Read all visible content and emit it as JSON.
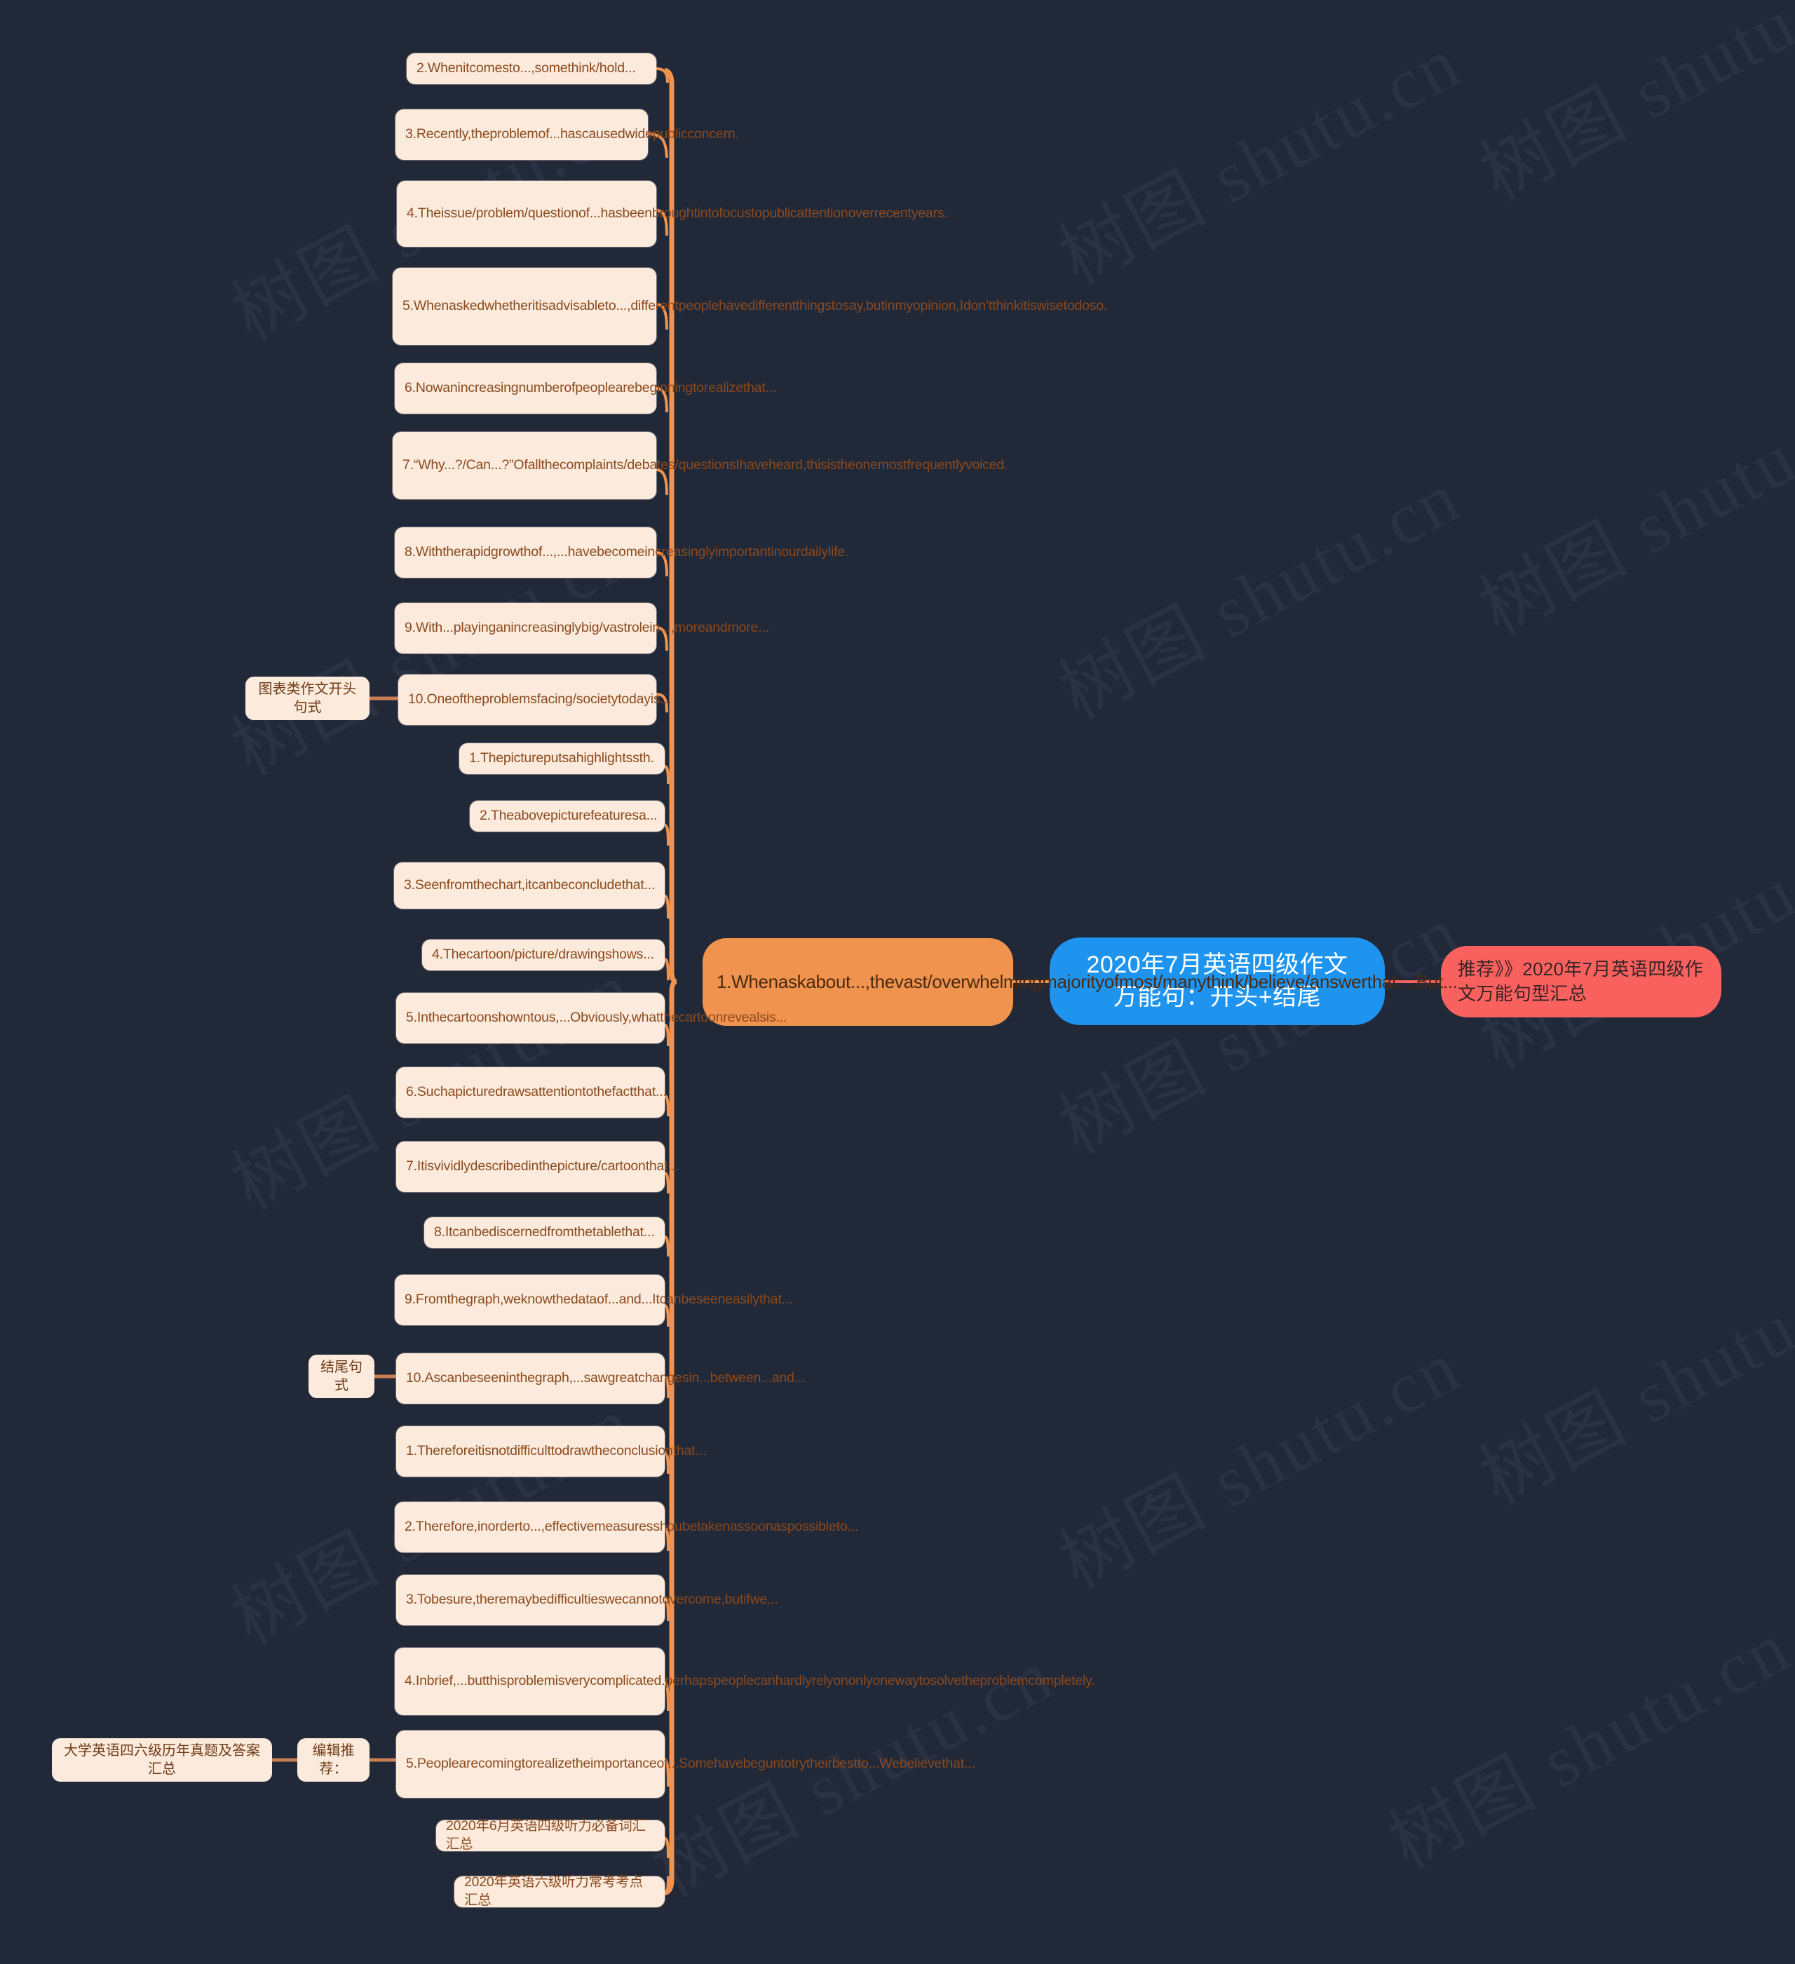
{
  "meta": {
    "background_color": "#212838",
    "leaf_fill": "#fcebdc",
    "leaf_text": "#8a4a1f",
    "root_fill": "#1f94ef",
    "orange_fill": "#f0934e",
    "red_fill": "#f9615f",
    "edge_color": "#f0934e",
    "watermark_text": "树图 shutu.cn"
  },
  "root": {
    "label": "2020年7月英语四级作文万能句：开头+结尾",
    "line1": "2020年7月英语四级作文",
    "line2": "万能句：开头+结尾"
  },
  "recommend": {
    "label": "推荐》》2020年7月英语四级作文万能句型汇总"
  },
  "opening_first": {
    "label": "1.Whenaskabout...,thevast/overwhelmingmajorityofmost/manythink/believe/answerthat....But..."
  },
  "branches": {
    "chart_opening": "图表类作文开头句式",
    "ending": "结尾句式",
    "editor_pick": "编辑推荐：",
    "exam_archive": "大学英语四六级历年真题及答案汇总"
  },
  "opening_items": [
    "2.Whenitcomesto...,somethink/hold...",
    "3.Recently,theproblemof...hascausedwidepublicconcern.",
    "4.Theissue/problem/questionof...hasbeenbroughtintofocustopublicattentionoverrecentyears.",
    "5.Whenaskedwhetheritisadvisableto...,differentpeoplehavedifferentthingstosay,butinmyopinion,Idon’tthinkitiswisetodoso.",
    "6.Nowanincreasingnumberofpeoplearebeginningtorealizethat...",
    "7.“Why...?/Can...?”Ofallthecomplaints/debates/questionsIhaveheard,thisistheonemostfrequentlyvoiced.",
    "8.Withtherapidgrowthof...,...havebecomeincreasinglyimportantinourdailylife.",
    "9.With...playinganincreasinglybig/vastrolein...,moreandmore...",
    "10.Oneoftheproblemsfacing/societytodayis..."
  ],
  "chart_items": [
    "1.Thepictureputsahighlightssth.",
    "2.Theabovepicturefeaturesa...",
    "3.Seenfromthechart,itcanbeconcludethat...",
    "4.Thecartoon/picture/drawingshows...",
    "5.Inthecartoonshowntous,...Obviously,whatthecartoonrevealsis...",
    "6.Suchapicturedrawsattentiontothefactthat...",
    "7.Itisvividlydescribedinthepicture/cartoonthat...",
    "8.Itcanbediscernedfromthetablethat...",
    "9.Fromthegraph,weknowthedataof...and...Itcanbeseeneasilythat...",
    "10.Ascanbeseeninthegraph,...sawgreatchangesin...between...and..."
  ],
  "ending_items": [
    "1.Thereforeitisnotdifficulttodrawtheconclusionthat...",
    "2.Therefore,inorderto...,effectivemeasuresshoubetakenassoonaspossibleto...",
    "3.Tobesure,theremaybedifficultieswecannotovercome,butifwe...",
    "4.Inbrief,...butthisproblemisverycomplicated.perhapspeoplecanhardlyrelyononlyonewaytosolvetheproblemcompletely.",
    "5.Peoplearecomingtorealizetheimportanceof...Somehavebeguntotrytheirbestto...Webelievethat..."
  ],
  "footer_items": [
    "2020年6月英语四级听力必备词汇汇总",
    "2020年英语六级听力常考考点汇总"
  ]
}
